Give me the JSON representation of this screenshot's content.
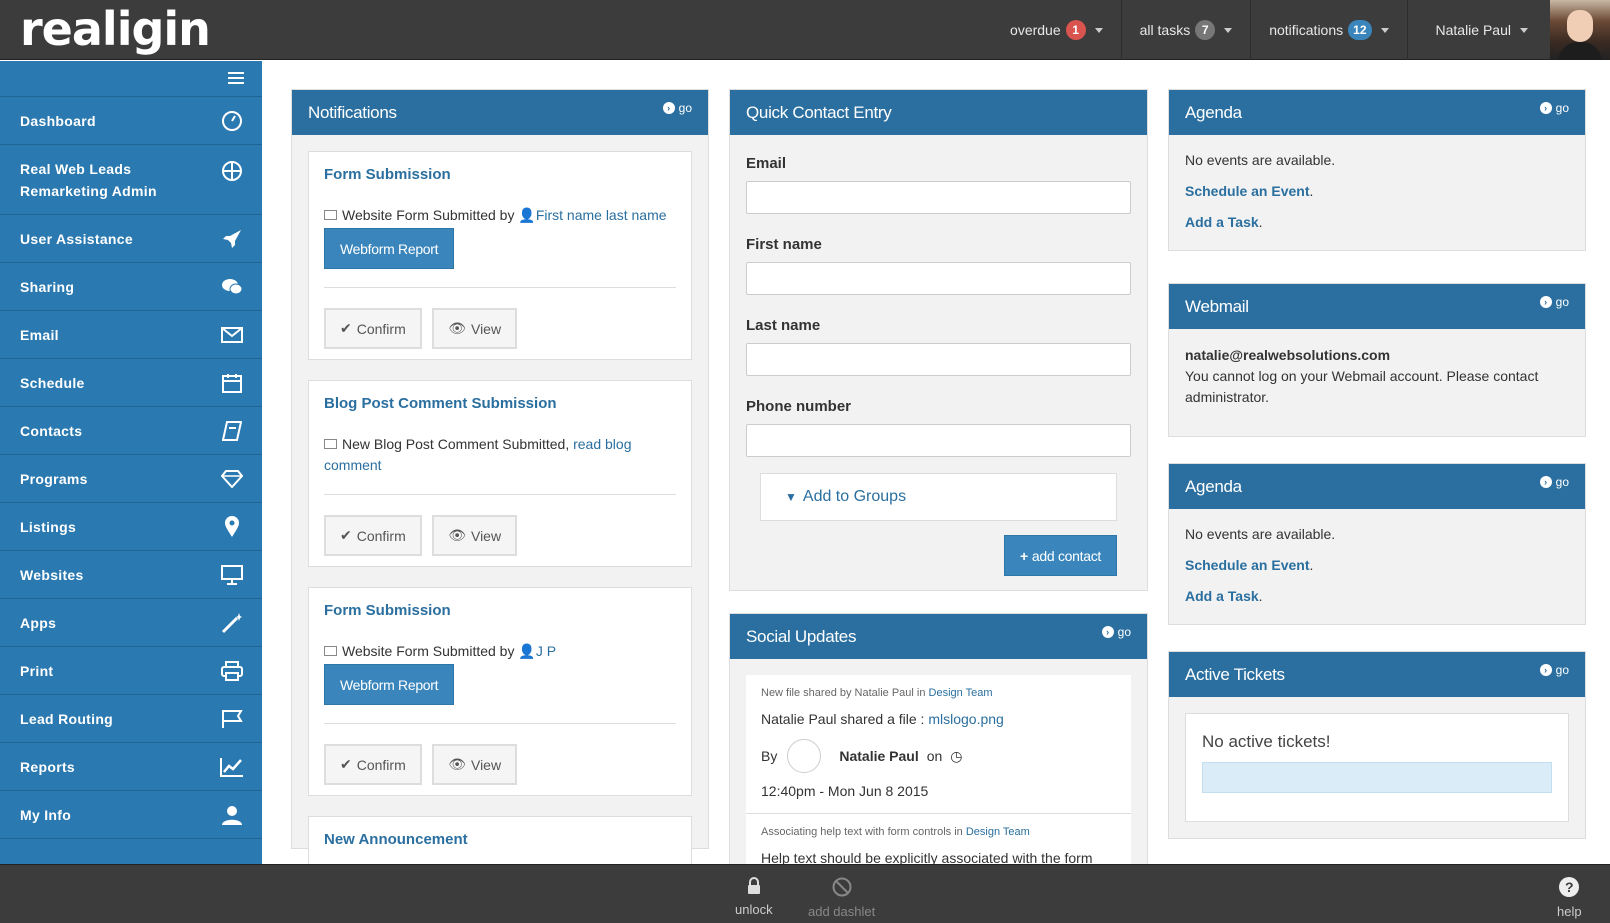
{
  "app": {
    "logo": "realigin"
  },
  "topnav": {
    "overdue": {
      "label": "overdue",
      "count": "1",
      "color": "#d9534f"
    },
    "tasks": {
      "label": "all tasks",
      "count": "7",
      "color": "#777777"
    },
    "notifications": {
      "label": "notifications",
      "count": "12",
      "color": "#3a86bc"
    },
    "user": {
      "name": "Natalie Paul"
    }
  },
  "sidebar": {
    "items": [
      {
        "label": "Dashboard",
        "icon": "dashboard-icon"
      },
      {
        "label": "Real Web Leads Remarketing Admin",
        "icon": "crosshair-icon"
      },
      {
        "label": "User Assistance",
        "icon": "rocket-icon"
      },
      {
        "label": "Sharing",
        "icon": "chat-bubbles-icon"
      },
      {
        "label": "Email",
        "icon": "envelope-icon"
      },
      {
        "label": "Schedule",
        "icon": "calendar-icon"
      },
      {
        "label": "Contacts",
        "icon": "book-icon"
      },
      {
        "label": "Programs",
        "icon": "diamond-icon"
      },
      {
        "label": "Listings",
        "icon": "map-pin-icon"
      },
      {
        "label": "Websites",
        "icon": "monitor-icon"
      },
      {
        "label": "Apps",
        "icon": "magic-wand-icon"
      },
      {
        "label": "Print",
        "icon": "printer-icon"
      },
      {
        "label": "Lead Routing",
        "icon": "flags-icon"
      },
      {
        "label": "Reports",
        "icon": "line-chart-icon"
      },
      {
        "label": "My Info",
        "icon": "user-icon"
      }
    ]
  },
  "common": {
    "go": "go",
    "confirm": "Confirm",
    "view": "View"
  },
  "notifications": {
    "title": "Notifications",
    "cards": [
      {
        "title": "Form Submission",
        "text": "Website Form Submitted by",
        "link": "First name last name",
        "button": "Webform Report"
      },
      {
        "title": "Blog Post Comment Submission",
        "text": "New Blog Post Comment Submitted,",
        "link": "read blog comment"
      },
      {
        "title": "Form Submission",
        "text": "Website Form Submitted by",
        "link": "J P",
        "button": "Webform Report"
      },
      {
        "title": "New Announcement"
      }
    ]
  },
  "quick_contact": {
    "title": "Quick Contact Entry",
    "fields": [
      "Email",
      "First name",
      "Last name",
      "Phone number"
    ],
    "groups": "Add to Groups",
    "add": "add contact"
  },
  "social": {
    "title": "Social Updates",
    "items": [
      {
        "meta": "New file shared by Natalie Paul in",
        "team": "Design Team",
        "text": "Natalie Paul shared a file :",
        "file": "mlslogo.png",
        "by": "By",
        "author": "Natalie Paul",
        "on": "on",
        "time": "12:40pm - Mon Jun 8 2015"
      },
      {
        "meta": "Associating help text with form controls in",
        "team": "Design Team",
        "text": "Help text should be explicitly associated with the form"
      }
    ]
  },
  "agenda1": {
    "title": "Agenda",
    "empty": "No events are available.",
    "schedule": "Schedule an Event",
    "task": "Add a Task"
  },
  "webmail": {
    "title": "Webmail",
    "email": "natalie@realwebsolutions.com",
    "message": "You cannot log on your Webmail account. Please contact administrator."
  },
  "agenda2": {
    "title": "Agenda",
    "empty": "No events are available.",
    "schedule": "Schedule an Event",
    "task": "Add a Task"
  },
  "tickets": {
    "title": "Active Tickets",
    "empty": "No active tickets!"
  },
  "statusbar": {
    "unlock": "unlock",
    "add_dashlet": "add dashlet",
    "help": "help"
  }
}
